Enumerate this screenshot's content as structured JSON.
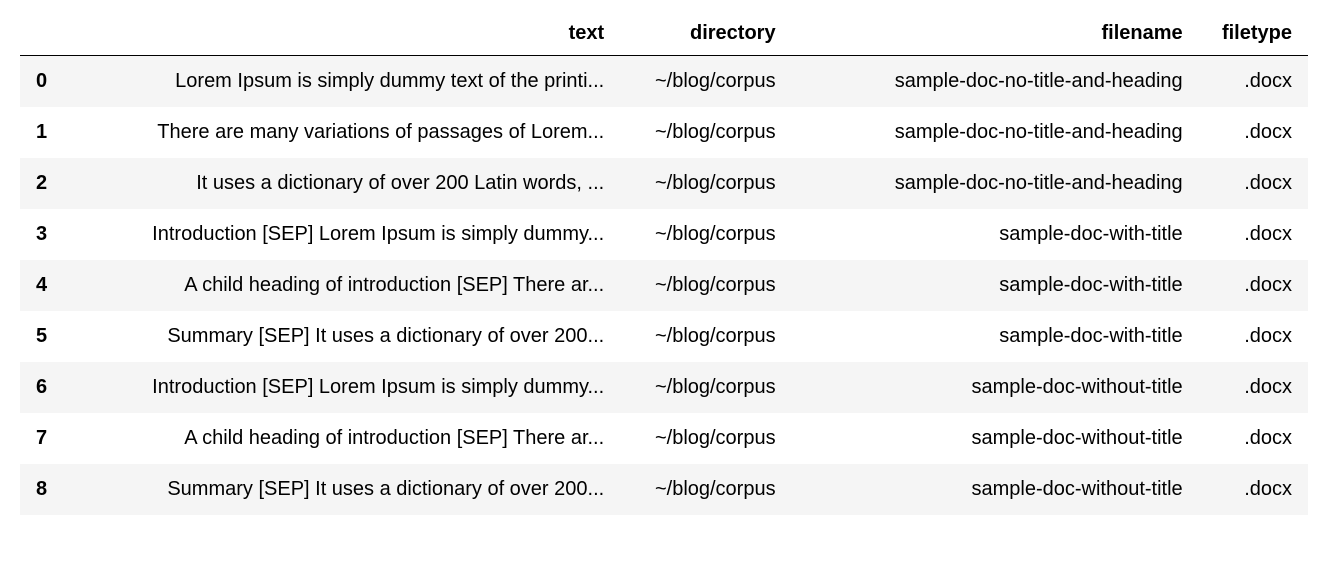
{
  "table": {
    "columns": {
      "index": "",
      "text": "text",
      "directory": "directory",
      "filename": "filename",
      "filetype": "filetype"
    },
    "rows": [
      {
        "index": "0",
        "text": "Lorem Ipsum is simply dummy text of the printi...",
        "directory": "~/blog/corpus",
        "filename": "sample-doc-no-title-and-heading",
        "filetype": ".docx"
      },
      {
        "index": "1",
        "text": "There are many variations of passages of Lorem...",
        "directory": "~/blog/corpus",
        "filename": "sample-doc-no-title-and-heading",
        "filetype": ".docx"
      },
      {
        "index": "2",
        "text": "It uses a dictionary of over 200 Latin words, ...",
        "directory": "~/blog/corpus",
        "filename": "sample-doc-no-title-and-heading",
        "filetype": ".docx"
      },
      {
        "index": "3",
        "text": "Introduction [SEP] Lorem Ipsum is simply dummy...",
        "directory": "~/blog/corpus",
        "filename": "sample-doc-with-title",
        "filetype": ".docx"
      },
      {
        "index": "4",
        "text": "A child heading of introduction [SEP] There ar...",
        "directory": "~/blog/corpus",
        "filename": "sample-doc-with-title",
        "filetype": ".docx"
      },
      {
        "index": "5",
        "text": "Summary [SEP] It uses a dictionary of over 200...",
        "directory": "~/blog/corpus",
        "filename": "sample-doc-with-title",
        "filetype": ".docx"
      },
      {
        "index": "6",
        "text": "Introduction [SEP] Lorem Ipsum is simply dummy...",
        "directory": "~/blog/corpus",
        "filename": "sample-doc-without-title",
        "filetype": ".docx"
      },
      {
        "index": "7",
        "text": "A child heading of introduction [SEP] There ar...",
        "directory": "~/blog/corpus",
        "filename": "sample-doc-without-title",
        "filetype": ".docx"
      },
      {
        "index": "8",
        "text": "Summary [SEP] It uses a dictionary of over 200...",
        "directory": "~/blog/corpus",
        "filename": "sample-doc-without-title",
        "filetype": ".docx"
      }
    ]
  }
}
